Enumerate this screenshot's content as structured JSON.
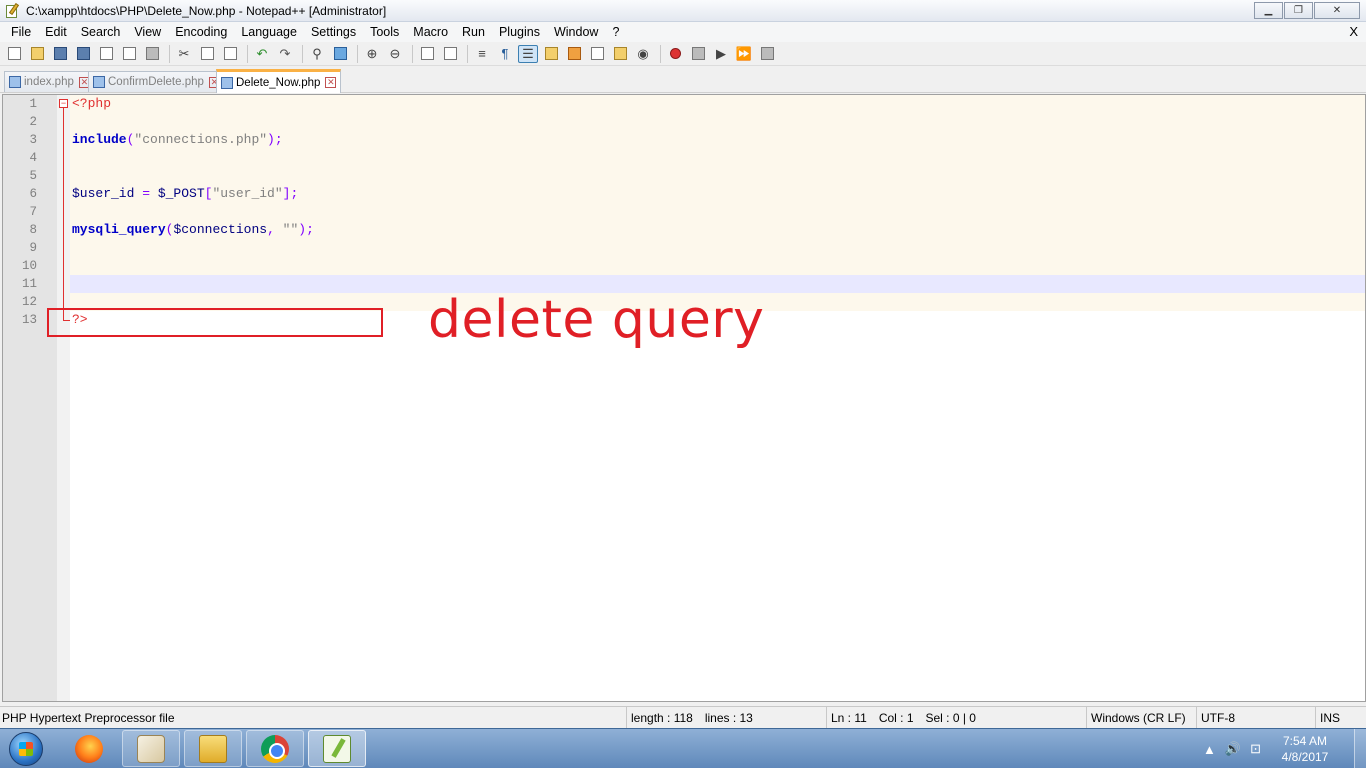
{
  "window": {
    "title": "C:\\xampp\\htdocs\\PHP\\Delete_Now.php - Notepad++ [Administrator]",
    "minimize_glyph": "▁",
    "restore_glyph": "❐",
    "close_glyph": "✕"
  },
  "menu": {
    "items": [
      "File",
      "Edit",
      "Search",
      "View",
      "Encoding",
      "Language",
      "Settings",
      "Tools",
      "Macro",
      "Run",
      "Plugins",
      "Window",
      "?"
    ],
    "close_glyph": "X"
  },
  "tabs": [
    {
      "label": "index.php",
      "active": false
    },
    {
      "label": "ConfirmDelete.php",
      "active": false
    },
    {
      "label": "Delete_Now.php",
      "active": true
    }
  ],
  "editor": {
    "fold_glyph": "−",
    "lines": [
      {
        "num": "1",
        "tokens": [
          {
            "t": "<?php",
            "c": "tag"
          }
        ]
      },
      {
        "num": "2",
        "tokens": []
      },
      {
        "num": "3",
        "tokens": [
          {
            "t": "include",
            "c": "fn"
          },
          {
            "t": "(",
            "c": "op"
          },
          {
            "t": "\"connections.php\"",
            "c": "str"
          },
          {
            "t": ");",
            "c": "op"
          }
        ]
      },
      {
        "num": "4",
        "tokens": []
      },
      {
        "num": "5",
        "tokens": []
      },
      {
        "num": "6",
        "tokens": [
          {
            "t": "$user_id",
            "c": "var"
          },
          {
            "t": " = ",
            "c": "op"
          },
          {
            "t": "$_POST",
            "c": "var"
          },
          {
            "t": "[",
            "c": "op"
          },
          {
            "t": "\"user_id\"",
            "c": "str"
          },
          {
            "t": "];",
            "c": "op"
          }
        ]
      },
      {
        "num": "7",
        "tokens": []
      },
      {
        "num": "8",
        "tokens": [
          {
            "t": "mysqli_query",
            "c": "fn"
          },
          {
            "t": "(",
            "c": "op"
          },
          {
            "t": "$connections",
            "c": "var"
          },
          {
            "t": ", ",
            "c": "op"
          },
          {
            "t": "\"\"",
            "c": "str"
          },
          {
            "t": ");",
            "c": "op"
          }
        ]
      },
      {
        "num": "9",
        "tokens": []
      },
      {
        "num": "10",
        "tokens": []
      },
      {
        "num": "11",
        "tokens": [],
        "current": true
      },
      {
        "num": "12",
        "tokens": []
      },
      {
        "num": "13",
        "tokens": [
          {
            "t": "?>",
            "c": "tag"
          }
        ],
        "outside": true
      }
    ],
    "annotation": "delete query"
  },
  "status": {
    "file_type": "PHP Hypertext Preprocessor file",
    "length": "length : 118",
    "lines": "lines : 13",
    "ln": "Ln : 11",
    "col": "Col : 1",
    "sel": "Sel : 0 | 0",
    "eol": "Windows (CR LF)",
    "encoding": "UTF-8",
    "mode": "INS"
  },
  "taskbar": {
    "time": "7:54 AM",
    "date": "4/8/2017",
    "tray_glyphs": [
      "▲",
      "🔊",
      "⊡"
    ]
  },
  "colors": {
    "annotation": "#e01f26",
    "tab_accent": "#fab145",
    "current_line": "#e8e8ff"
  }
}
